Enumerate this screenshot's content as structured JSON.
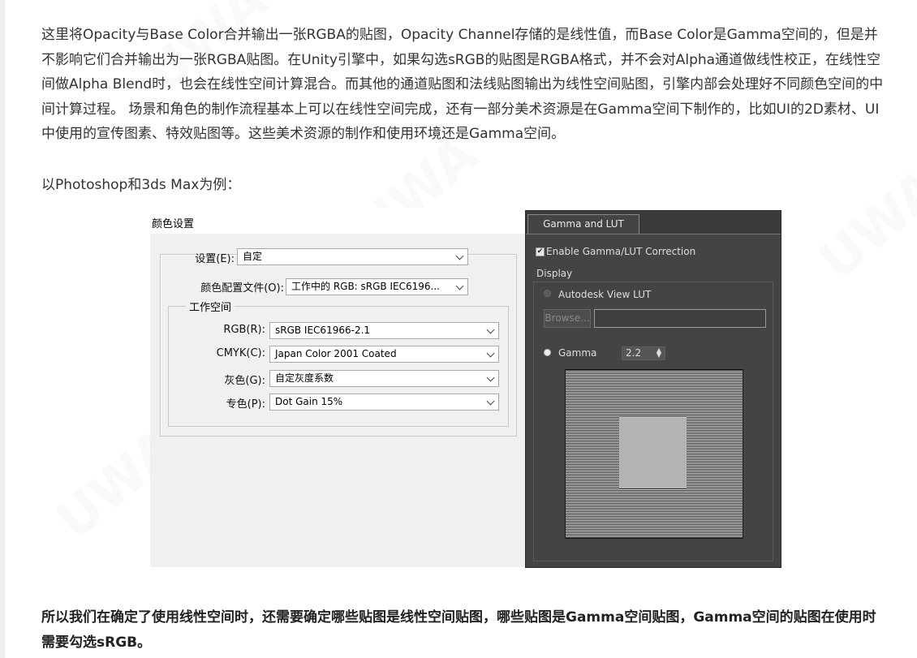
{
  "article": {
    "para1": "这里将Opacity与Base Color合并输出一张RGBA的贴图，Opacity Channel存储的是线性值，而Base Color是Gamma空间的，但是并不影响它们合并输出为一张RGBA贴图。在Unity引擎中，如果勾选sRGB的贴图是RGBA格式，并不会对Alpha通道做线性校正，在线性空间做Alpha Blend时，也会在线性空间计算混合。而其他的通道贴图和法线贴图输出为线性空间贴图，引擎内部会处理好不同颜色空间的中间计算过程。 场景和角色的制作流程基本上可以在线性空间完成，还有一部分美术资源是在Gamma空间下制作的，比如UI的2D素材、UI中使用的宣传图素、特效贴图等。这些美术资源的制作和使用环境还是Gamma空间。",
    "para2": "以Photoshop和3ds Max为例：",
    "para3": "所以我们在确定了使用线性空间时，还需要确定哪些贴图是线性空间贴图，哪些贴图是Gamma空间贴图，Gamma空间的贴图在使用时需要勾选sRGB。"
  },
  "photoshop": {
    "title": "颜色设置",
    "settings_label": "设置(E):",
    "settings_value": "自定",
    "profile_label": "颜色配置文件(O):",
    "profile_value": "工作中的 RGB: sRGB IEC6196...",
    "workspace_title": "工作空间",
    "rgb_label": "RGB(R):",
    "rgb_value": "sRGB IEC61966-2.1",
    "cmyk_label": "CMYK(C):",
    "cmyk_value": "Japan Color 2001 Coated",
    "gray_label": "灰色(G):",
    "gray_value": "自定灰度系数",
    "spot_label": "专色(P):",
    "spot_value": "Dot Gain 15%"
  },
  "max": {
    "tab_label": "Gamma and LUT",
    "enable_label": "Enable Gamma/LUT Correction",
    "display_label": "Display",
    "autodesk_lut_label": "Autodesk View LUT",
    "browse_label": "Browse...",
    "gamma_label": "Gamma",
    "gamma_value": "2.2"
  }
}
